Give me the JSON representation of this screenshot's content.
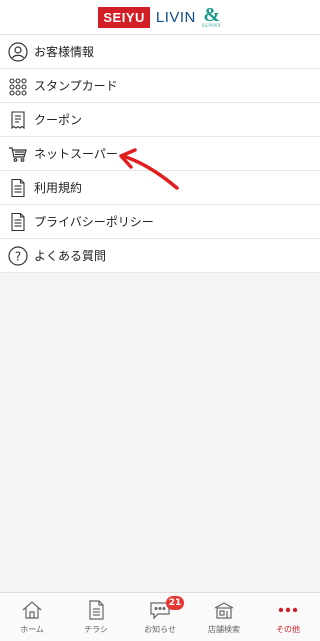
{
  "header": {
    "brand_seiyu": "SEIYU",
    "brand_livin": "LIVIN",
    "brand_sunny_mark": "&",
    "brand_sunny": "SUNNY"
  },
  "menu": {
    "items": [
      {
        "label": "お客様情報",
        "icon": "person-circle-icon"
      },
      {
        "label": "スタンプカード",
        "icon": "stamp-grid-icon"
      },
      {
        "label": "クーポン",
        "icon": "coupon-receipt-icon"
      },
      {
        "label": "ネットスーパー",
        "icon": "shopping-cart-icon"
      },
      {
        "label": "利用規約",
        "icon": "document-icon"
      },
      {
        "label": "プライバシーポリシー",
        "icon": "document-icon"
      },
      {
        "label": "よくある質問",
        "icon": "question-circle-icon"
      }
    ]
  },
  "annotation": {
    "icon": "red-arrow-icon",
    "color": "#e01e1e"
  },
  "tabbar": {
    "tabs": [
      {
        "label": "ホーム",
        "icon": "home-icon"
      },
      {
        "label": "チラシ",
        "icon": "flyer-icon"
      },
      {
        "label": "お知らせ",
        "icon": "chat-bubble-icon",
        "badge": "21"
      },
      {
        "label": "店舗検索",
        "icon": "store-icon"
      },
      {
        "label": "その他",
        "icon": "more-dots-icon",
        "active": true
      }
    ]
  },
  "colors": {
    "brand_red": "#d21f26",
    "livin_blue": "#0f4c8a",
    "sunny_teal": "#1a9a8a",
    "active_tab": "#d21f26"
  }
}
